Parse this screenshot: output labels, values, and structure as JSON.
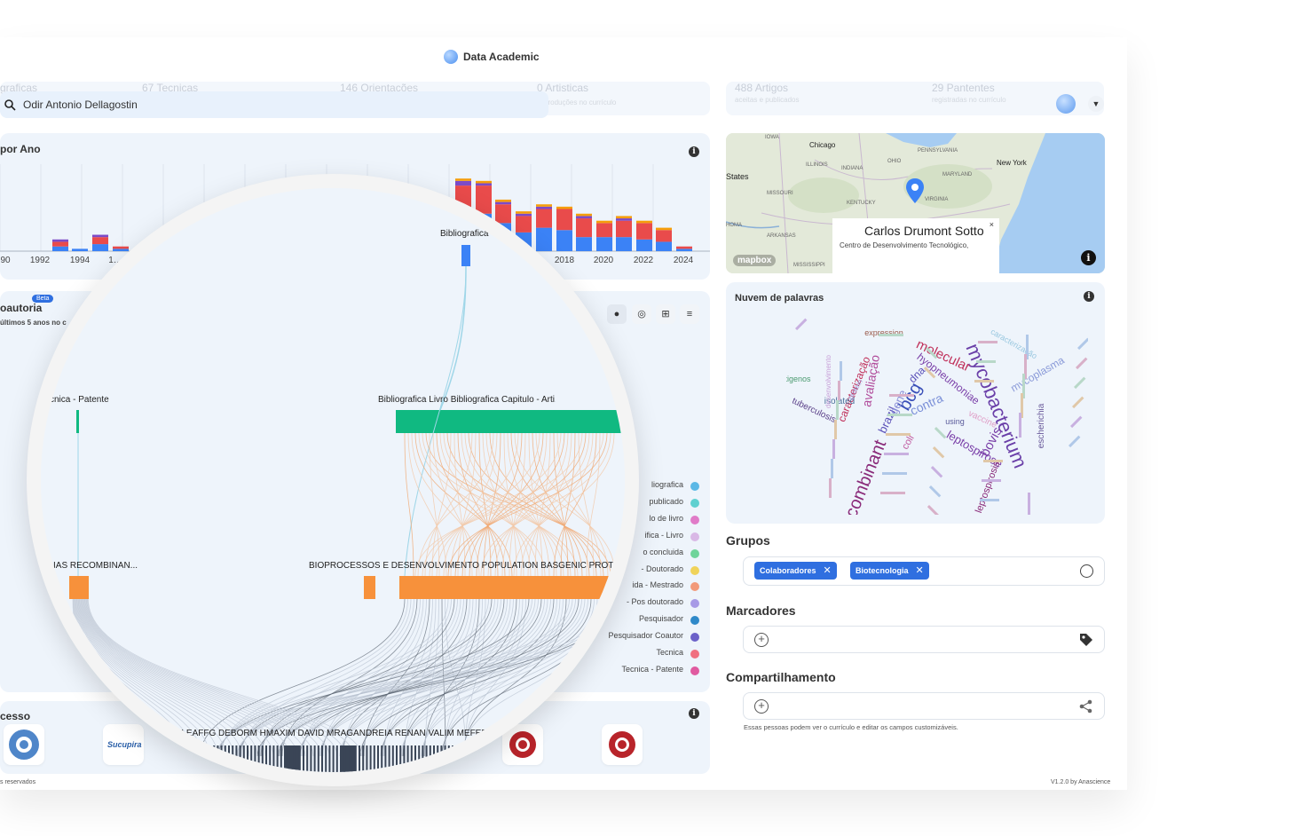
{
  "brand": {
    "name": "Data Academic"
  },
  "header": {
    "stats": [
      {
        "label": "graficas",
        "sub": ""
      },
      {
        "label": "67 Tecnicas",
        "sub": ""
      },
      {
        "label": "146 Orientações",
        "sub": ""
      },
      {
        "label": "0 Artisticas",
        "sub": "produções no currículo"
      },
      {
        "label": "488 Artigos",
        "sub": "aceitas e publicados"
      },
      {
        "label": "29 Pantentes",
        "sub": "registradas no currículo"
      }
    ],
    "search_value": "Odir Antonio Dellagostin"
  },
  "production_chart": {
    "title": "por Ano",
    "chart_data": {
      "type": "bar",
      "stacked": true,
      "categories": [
        "1990",
        "1991",
        "1992",
        "1993",
        "1994",
        "1995",
        "2013",
        "2014",
        "2015",
        "2016",
        "2017",
        "2018",
        "2019",
        "2020",
        "2021",
        "2022",
        "2023",
        "2024"
      ],
      "series": [
        {
          "name": "",
          "color": "#3b82f6",
          "values": [
            0,
            0,
            2,
            1,
            3,
            1,
            18,
            16,
            12,
            8,
            10,
            9,
            6,
            6,
            6,
            5,
            4,
            1
          ]
        },
        {
          "name": "",
          "color": "#e94b4b",
          "values": [
            0,
            0,
            2,
            0,
            3,
            1,
            10,
            12,
            8,
            7,
            8,
            9,
            8,
            6,
            7,
            7,
            5,
            1
          ]
        },
        {
          "name": "",
          "color": "#7c4bc8",
          "values": [
            0,
            0,
            1,
            0,
            1,
            0,
            2,
            1,
            1,
            1,
            1,
            0,
            1,
            0,
            1,
            0,
            0,
            0
          ]
        },
        {
          "name": "",
          "color": "#f59e0b",
          "values": [
            0,
            0,
            0,
            0,
            0,
            0,
            1,
            1,
            1,
            1,
            1,
            1,
            1,
            1,
            1,
            1,
            1,
            0
          ]
        }
      ],
      "tick_labels": [
        "90",
        "1992",
        "1994",
        "1…",
        "2018",
        "2020",
        "2022",
        "2024"
      ]
    }
  },
  "coauthor": {
    "title": "oautoria",
    "subtitle": "últimos 5 anos no c",
    "beta": "Beta",
    "toolbar": [
      "bubble-icon",
      "globe-icon",
      "tree-icon",
      "list-icon"
    ],
    "legend": [
      {
        "label": "liografica",
        "color": "#5bb8e6"
      },
      {
        "label": "publicado",
        "color": "#5fd0d0"
      },
      {
        "label": "lo de livro",
        "color": "#e07bc8"
      },
      {
        "label": "ifica - Livro",
        "color": "#d9b8e6"
      },
      {
        "label": "o concluida",
        "color": "#6fd49a"
      },
      {
        "label": "- Doutorado",
        "color": "#f0d35a"
      },
      {
        "label": "ida - Mestrado",
        "color": "#f29a7a"
      },
      {
        "label": "- Pos doutorado",
        "color": "#a79ae6"
      },
      {
        "label": "Pesquisador",
        "color": "#2f89c9"
      },
      {
        "label": "Pesquisador Coautor",
        "color": "#6b61c9"
      },
      {
        "label": "Tecnica",
        "color": "#f07080"
      },
      {
        "label": "Tecnica - Patente",
        "color": "#e05aa0"
      }
    ]
  },
  "sankey": {
    "labels": {
      "top": "Bibliografica",
      "mid_left": "cnica - Patente",
      "mid_right": "Bibliografica Livro Bibliografica Capitulo - Arti...",
      "low_left": "IAS RECOMBINAN...",
      "low_right": "BIOPROCESSOS E DESENVOLVIMENTO POPULATION BASGENIC PROTECTION",
      "bottom": "...LEAFFG DEBORM HMAXIM DAVID MRAGANDREIA RENAN VALIM MEFER..."
    }
  },
  "access": {
    "title": "cesso",
    "footer": "s reservados",
    "logos": [
      "pubmed-logo",
      "sucupira-logo",
      "lattes-logo",
      "lattes-logo-2"
    ]
  },
  "map": {
    "labels": [
      "Chicago",
      "New York",
      "States",
      "IOWA",
      "ILLINOIS",
      "INDIANA",
      "OHIO",
      "PENNSYLVANIA",
      "MISSOURI",
      "KENTUCKY",
      "VIRGINIA",
      "ARKANSAS",
      "HOMA",
      "MARYLAND",
      "MISSISSIPPI"
    ],
    "popup_name": "Carlos Drumont Sotto",
    "popup_inst": "Centro de Desenvolvimento Tecnológico,",
    "logo_text": "mapbox",
    "colors": {
      "water": "#9fc7f0",
      "land": "#dfe7d4",
      "pin": "#3b82f6"
    }
  },
  "wordcloud": {
    "title": "Nuvem de palavras",
    "words": [
      {
        "text": "mycobacterium",
        "size": 22,
        "color": "#6a3fa8"
      },
      {
        "text": "recombinant",
        "size": 20,
        "color": "#8a2b7a"
      },
      {
        "text": "bcg",
        "size": 20,
        "color": "#3a4fb8"
      },
      {
        "text": "molecular",
        "size": 15,
        "color": "#c0305a"
      },
      {
        "text": "hyopneumoniae",
        "size": 12,
        "color": "#7a3fa8"
      },
      {
        "text": "bovis",
        "size": 15,
        "color": "#7a3fa8"
      },
      {
        "text": "leptospirose",
        "size": 13,
        "color": "#7a3fa8"
      },
      {
        "text": "leptospirosis",
        "size": 11,
        "color": "#8a2b7a"
      },
      {
        "text": "avaliação",
        "size": 14,
        "color": "#b04a9a"
      },
      {
        "text": "caracterização",
        "size": 12,
        "color": "#c0305a"
      },
      {
        "text": "brazil",
        "size": 13,
        "color": "#5a4fb8"
      },
      {
        "text": "gene",
        "size": 13,
        "color": "#8a8fd8"
      },
      {
        "text": "dna",
        "size": 12,
        "color": "#5a4fb8"
      },
      {
        "text": "contra",
        "size": 14,
        "color": "#7a8fd8"
      },
      {
        "text": "coli",
        "size": 11,
        "color": "#c05aa0"
      },
      {
        "text": "mycoplasma",
        "size": 12,
        "color": "#8a9ad8"
      },
      {
        "text": "tuberculosis",
        "size": 10,
        "color": "#5a3f88"
      },
      {
        "text": "isolated",
        "size": 10,
        "color": "#4a6f9a"
      },
      {
        "text": "antigenos",
        "size": 9,
        "color": "#4a9a6f"
      },
      {
        "text": "escherichia",
        "size": 10,
        "color": "#6a5a9a"
      },
      {
        "text": "vaccine",
        "size": 10,
        "color": "#e0a0c8"
      },
      {
        "text": "expression",
        "size": 9,
        "color": "#9a5a4a"
      },
      {
        "text": "using",
        "size": 9,
        "color": "#5a5a9a"
      },
      {
        "text": "caracterização",
        "size": 9,
        "color": "#9ac8e0"
      },
      {
        "text": "protein",
        "size": 8,
        "color": "#9a9ad8"
      },
      {
        "text": "desenvolvimento",
        "size": 8,
        "color": "#c8a0d8"
      }
    ]
  },
  "groups": {
    "title": "Grupos",
    "chips": [
      "Colaboradores",
      "Biotecnologia"
    ]
  },
  "markers": {
    "title": "Marcadores"
  },
  "sharing": {
    "title": "Compartilhamento",
    "note": "Essas pessoas podem ver o currículo e editar os campos customizáveis."
  },
  "footer": {
    "version": "V1.2.0 by Anascience"
  }
}
